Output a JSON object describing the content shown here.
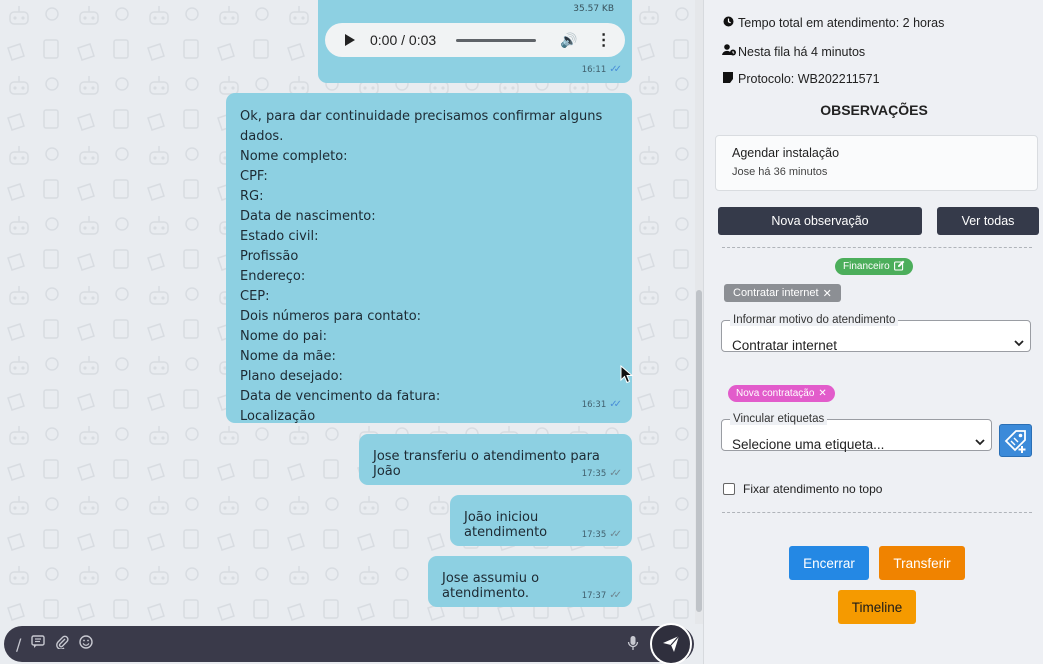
{
  "chat": {
    "audio_message": {
      "file_size": "35.57 KB",
      "player_time": "0:00 / 0:03",
      "time": "16:11"
    },
    "form_message": {
      "lines": [
        "Ok, para dar continuidade precisamos confirmar alguns dados.",
        "Nome completo:",
        "CPF:",
        "RG:",
        "Data de nascimento:",
        "Estado civil:",
        "Profissão",
        "Endereço:",
        "CEP:",
        "Dois números para contato:",
        "Nome do pai:",
        "Nome da mãe:",
        "Plano desejado:",
        "Data de vencimento da fatura:",
        "Localização"
      ],
      "time": "16:31"
    },
    "system_messages": [
      {
        "text": "Jose transferiu o atendimento para João",
        "time": "17:35"
      },
      {
        "text": "João iniciou atendimento",
        "time": "17:35"
      },
      {
        "text": "Jose assumiu o atendimento.",
        "time": "17:37"
      }
    ],
    "composer": {
      "icons": [
        "slash-icon",
        "quick-reply-icon",
        "attachment-icon",
        "emoji-icon",
        "microphone-icon",
        "send-icon"
      ]
    }
  },
  "panel": {
    "info": {
      "tempo_total": "Tempo total em atendimento: 2 horas",
      "fila": "Nesta fila há 4 minutos",
      "protocolo": "Protocolo: WB202211571"
    },
    "observacoes": {
      "title": "OBSERVAÇÕES",
      "card_title": "Agendar instalação",
      "card_subtitle": "Jose há 36 minutos",
      "new_button": "Nova observação",
      "all_button": "Ver todas"
    },
    "tags": {
      "department": "Financeiro",
      "reason_tag": "Contratar internet",
      "label_tag": "Nova contratação"
    },
    "motivo": {
      "legend": "Informar motivo do atendimento",
      "value": "Contratar internet"
    },
    "etiquetas": {
      "legend": "Vincular etiquetas",
      "value": "Selecione uma etiqueta..."
    },
    "fixar_label": "Fixar atendimento no topo",
    "actions": {
      "encerrar": "Encerrar",
      "transferir": "Transferir",
      "timeline": "Timeline"
    },
    "colors": {
      "bubble": "#8dd0e2",
      "dark_button": "#353a4a",
      "encerrar": "#2488e4",
      "transferir": "#f08300",
      "timeline": "#f59a00",
      "tag_financeiro": "#4cae5b",
      "tag_nova": "#e25ccb"
    }
  }
}
